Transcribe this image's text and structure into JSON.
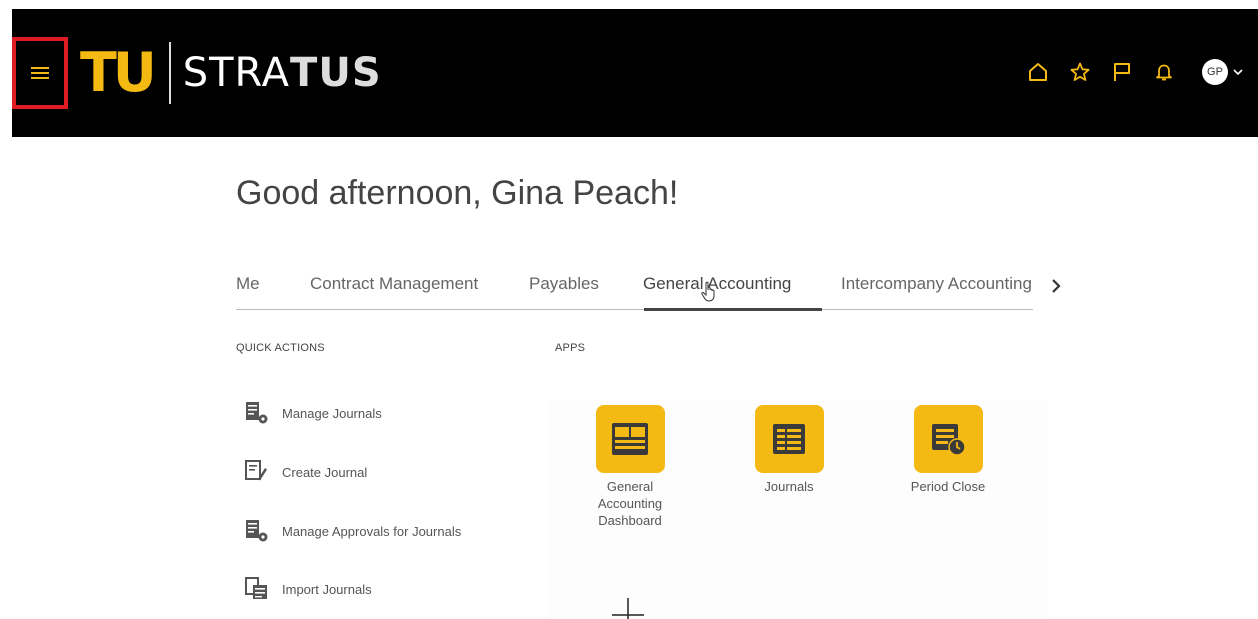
{
  "header": {
    "logo_mark": "TU",
    "logo_text_light": "STRA",
    "logo_text_bold": "TUS",
    "icons": [
      "home-icon",
      "star-icon",
      "flag-icon",
      "bell-icon"
    ],
    "avatar_initials": "GP",
    "accent_color": "#f5b914",
    "highlight_color": "#e01b24"
  },
  "greeting": "Good afternoon, Gina Peach!",
  "tabs": [
    {
      "label": "Me"
    },
    {
      "label": "Contract Management"
    },
    {
      "label": "Payables"
    },
    {
      "label": "General Accounting",
      "active": true
    },
    {
      "label": "Intercompany Accounting"
    }
  ],
  "quick_actions": {
    "heading": "QUICK ACTIONS",
    "items": [
      {
        "label": "Manage Journals",
        "icon": "manage-journals-icon"
      },
      {
        "label": "Create Journal",
        "icon": "create-journal-icon"
      },
      {
        "label": "Manage Approvals for Journals",
        "icon": "manage-approvals-icon"
      },
      {
        "label": "Import Journals",
        "icon": "import-journals-icon"
      }
    ]
  },
  "apps": {
    "heading": "APPS",
    "items": [
      {
        "label": "General Accounting Dashboard",
        "icon": "dashboard-icon"
      },
      {
        "label": "Journals",
        "icon": "journals-icon"
      },
      {
        "label": "Period Close",
        "icon": "period-close-icon"
      }
    ]
  }
}
